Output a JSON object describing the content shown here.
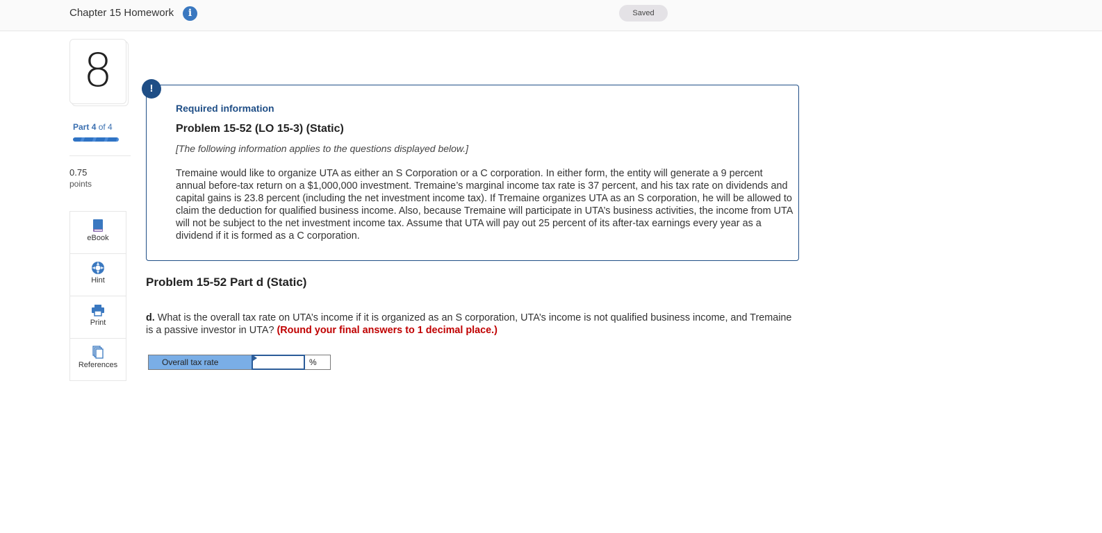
{
  "header": {
    "title": "Chapter 15 Homework",
    "info_icon": "info-icon",
    "saved_label": "Saved"
  },
  "sidebar": {
    "question_number": "8",
    "part_prefix": "Part",
    "part_current": "4",
    "part_suffix": "of 4",
    "progress": {
      "completed_parts": 4,
      "total_parts": 4
    },
    "points_value": "0.75",
    "points_label": "points",
    "tools": [
      {
        "label": "eBook",
        "icon": "book-icon"
      },
      {
        "label": "Hint",
        "icon": "lifebuoy-icon"
      },
      {
        "label": "Print",
        "icon": "printer-icon"
      },
      {
        "label": "References",
        "icon": "copy-documents-icon"
      }
    ]
  },
  "required_info": {
    "alert_icon_glyph": "!",
    "label": "Required information",
    "problem_title": "Problem 15-52 (LO 15-3) (Static)",
    "note": "[The following information applies to the questions displayed below.]",
    "body": "Tremaine would like to organize UTA as either an S Corporation or a C corporation. In either form, the entity will generate a 9 percent annual before-tax return on a $1,000,000 investment. Tremaine’s marginal income tax rate is 37 percent, and his tax rate on dividends and capital gains is 23.8 percent (including the net investment income tax). If Tremaine organizes UTA as an S corporation, he will be allowed to claim the deduction for qualified business income. Also, because Tremaine will participate in UTA’s business activities, the income from UTA will not be subject to the net investment income tax. Assume that UTA will pay out 25 percent of its after-tax earnings every year as a dividend if it is formed as a C corporation."
  },
  "question": {
    "part_title": "Problem 15-52 Part d (Static)",
    "prefix": "d.",
    "text": " What is the overall tax rate on UTA’s income if it is organized as an S corporation, UTA’s income is not qualified business income, and Tremaine is a passive investor in UTA? ",
    "rounding_note": "(Round your final answers to 1 decimal place.)"
  },
  "answer": {
    "label": "Overall tax rate",
    "value": "",
    "placeholder": "",
    "unit": "%"
  },
  "colors": {
    "accent_blue": "#1f4e86",
    "link_blue": "#3a6fb0",
    "answer_label_bg": "#7aaee6",
    "rounding_note_red": "#c00000"
  }
}
